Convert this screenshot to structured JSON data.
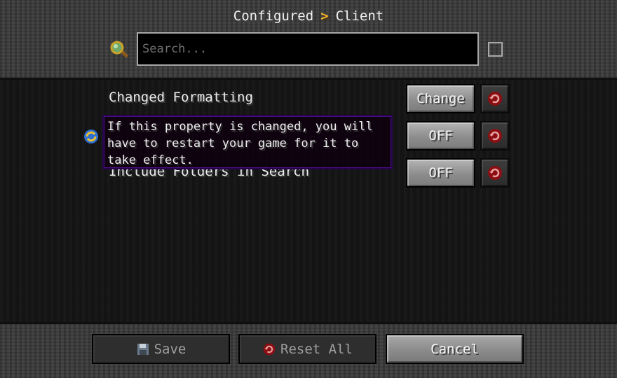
{
  "breadcrumb": {
    "root": "Configured",
    "separator": ">",
    "current": "Client"
  },
  "search": {
    "placeholder": "Search...",
    "value": ""
  },
  "rows": [
    {
      "label": "Changed Formatting",
      "button": "Change"
    },
    {
      "label": "",
      "button": "OFF"
    },
    {
      "label": "Include Folders in Search",
      "button": "OFF"
    }
  ],
  "tooltip": {
    "lines": [
      "If this property is changed, you will",
      "have to restart your game for it to",
      "take effect."
    ]
  },
  "footer": {
    "save": "Save",
    "reset_all": "Reset All",
    "cancel": "Cancel"
  },
  "colors": {
    "breadcrumb_separator": "#f2b531",
    "reset_icon": "#8b0e12",
    "tooltip_border": "#4a0f85"
  },
  "icons": {
    "search": "magnifier-icon",
    "reset": "reset-icon",
    "restart": "restart-required-icon",
    "save": "floppy-disk-icon"
  }
}
